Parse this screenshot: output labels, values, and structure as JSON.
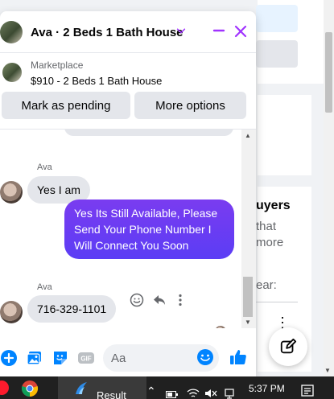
{
  "chat": {
    "title": "Ava · 2 Beds 1 Bath House",
    "marketplace_label": "Marketplace",
    "listing_title": "$910 - 2 Beds 1 Bath House",
    "mark_pending_label": "Mark as pending",
    "more_options_label": "More options",
    "messages": [
      {
        "sender": "Ava",
        "text": "Yes I am",
        "direction": "incoming"
      },
      {
        "text": "Yes Its Still Available, Please Send Your Phone Number I Will Connect You Soon",
        "direction": "outgoing"
      },
      {
        "sender": "Ava",
        "text": "716-329-1101",
        "direction": "incoming"
      }
    ],
    "composer_placeholder": "Aa",
    "accent_color": "#0084ff",
    "outgoing_gradient": [
      "#7a3cf0",
      "#5b3df5"
    ],
    "header_icon_color": "#a033ff"
  },
  "background": {
    "buyers_fragment": "uyers",
    "that_fragment": "that",
    "more_fragment": "more",
    "ear_fragment": "ear:"
  },
  "taskbar": {
    "app_label": "Result",
    "time": "5:37 PM"
  }
}
